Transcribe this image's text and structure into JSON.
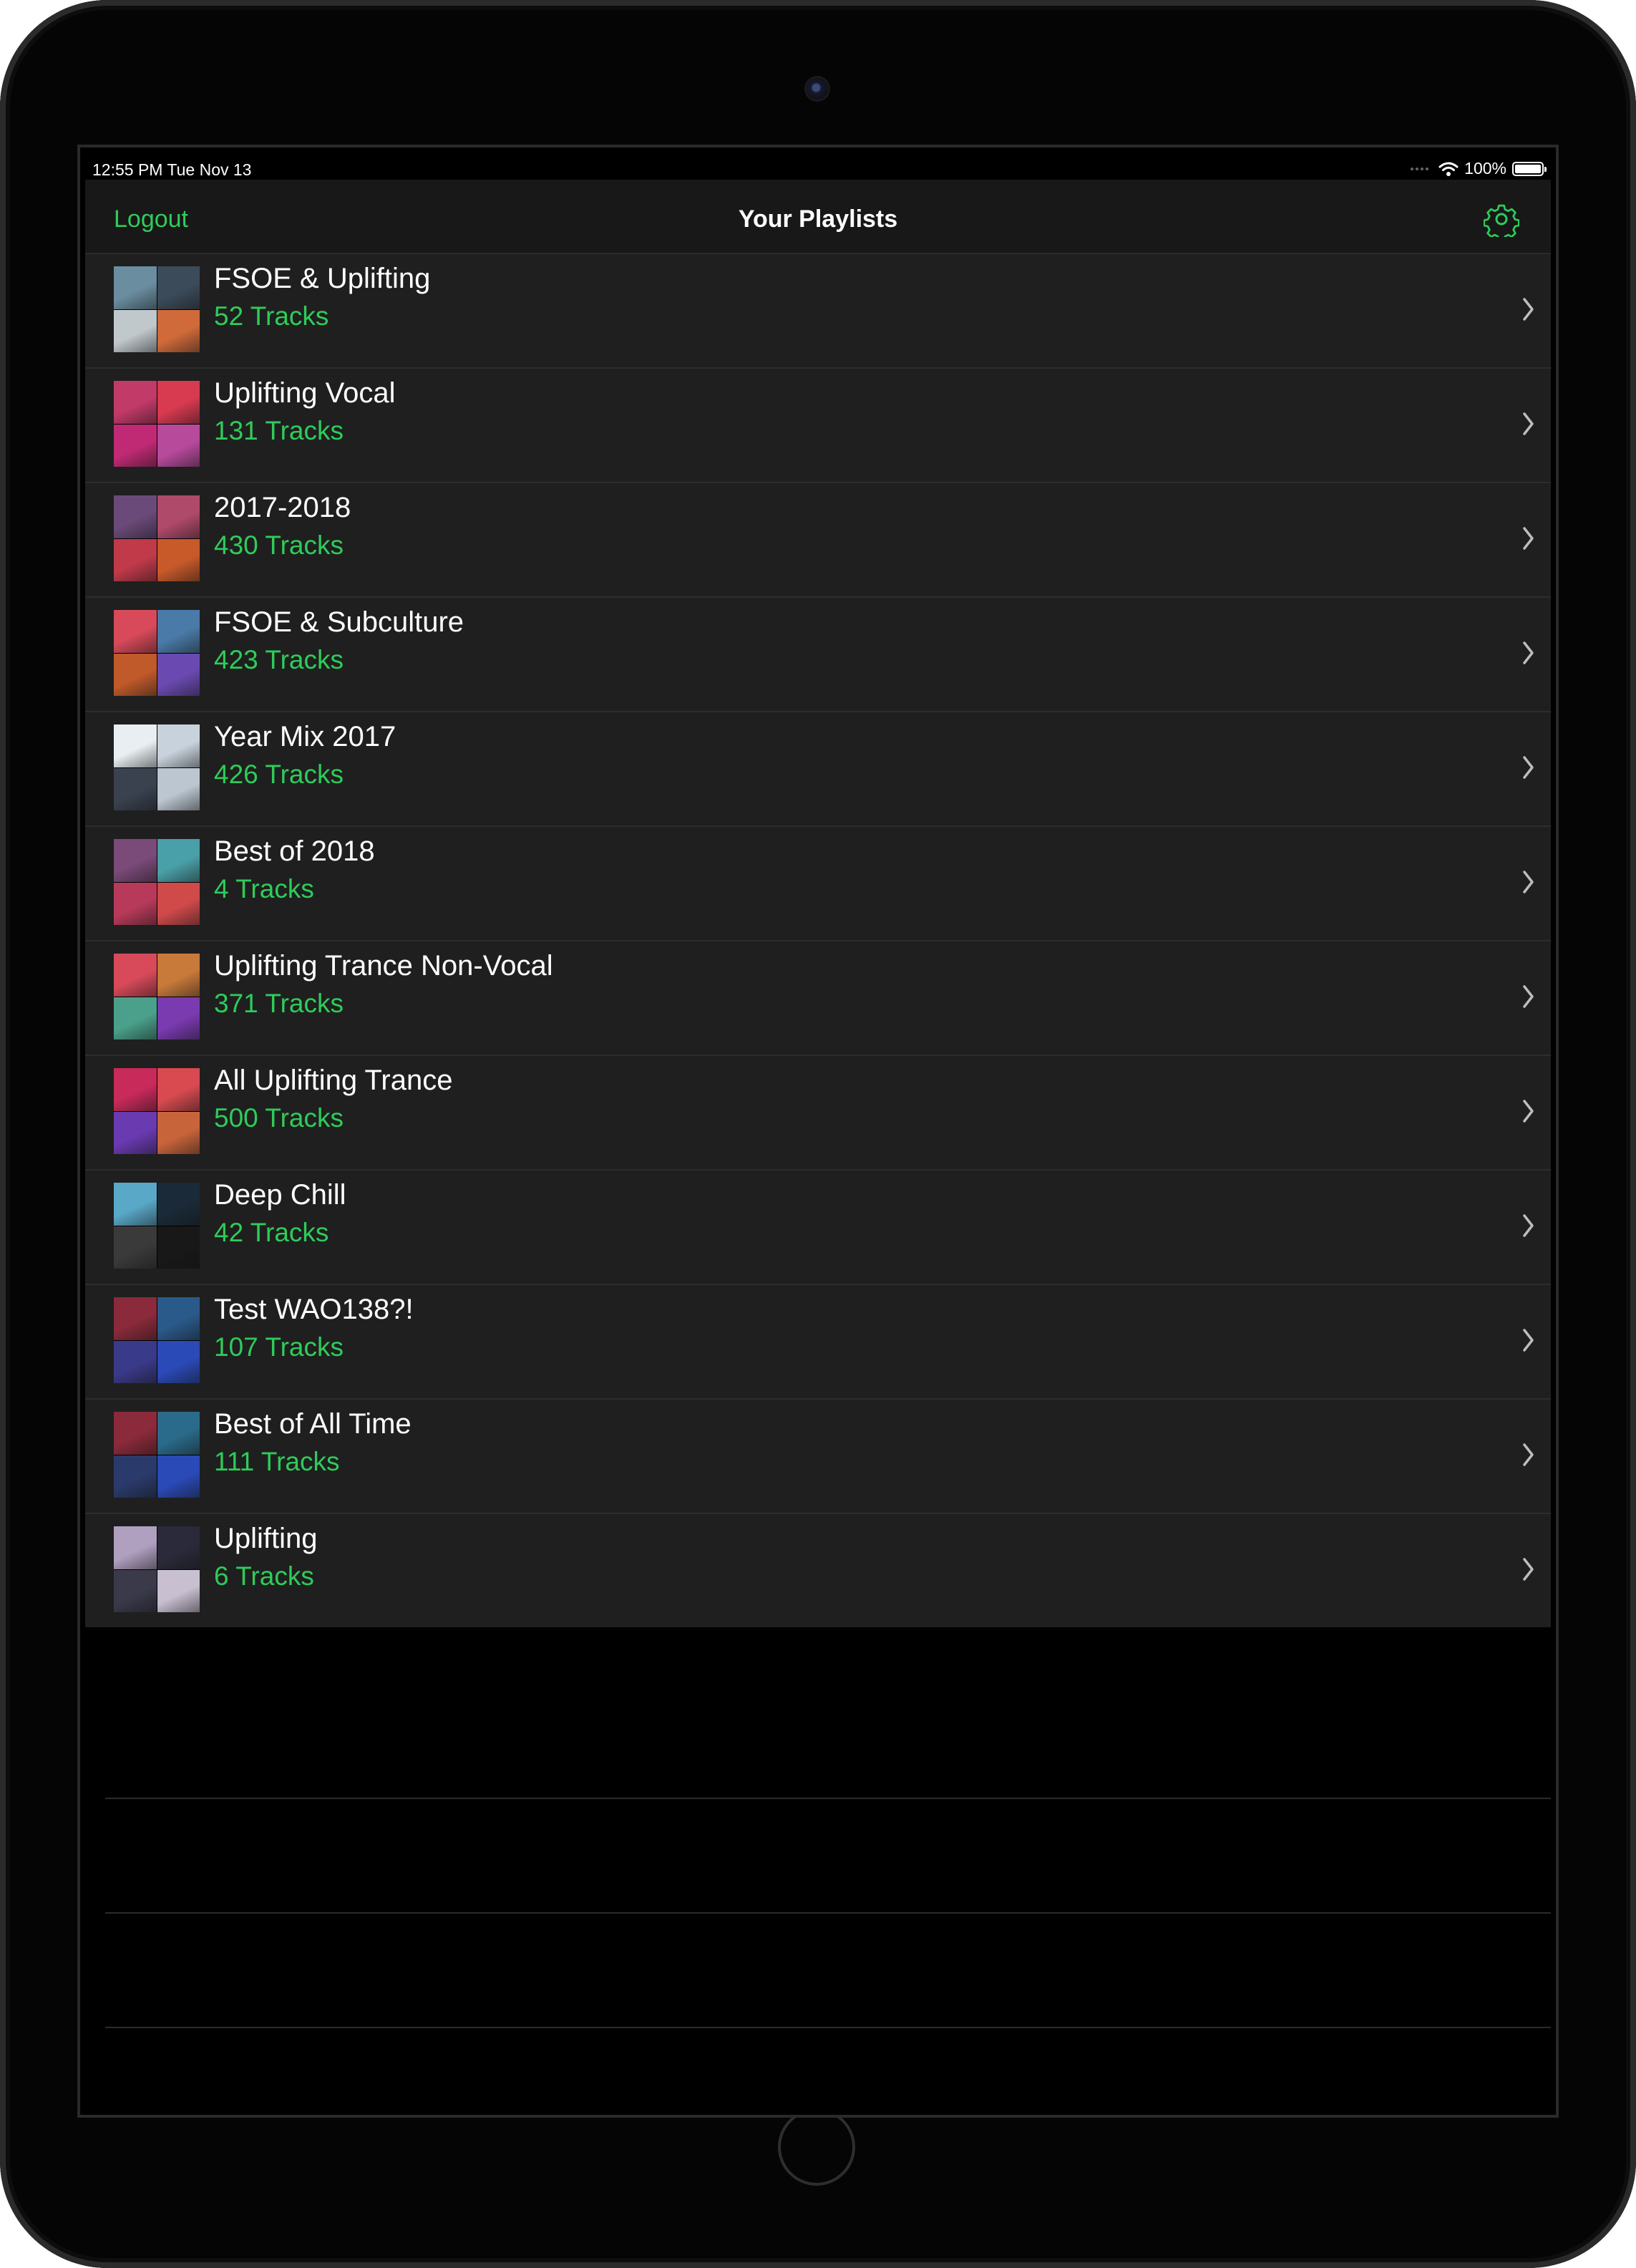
{
  "status_bar": {
    "time": "12:55 PM   Tue Nov 13",
    "battery": "100%"
  },
  "nav": {
    "left": "Logout",
    "title": "Your Playlists",
    "right_icon": "gear-icon"
  },
  "colors": {
    "accent": "#2ecc5a",
    "row_bg": "#1f1f1f",
    "nav_bg": "#181818"
  },
  "playlists": [
    {
      "name": "FSOE & Uplifting",
      "tracks": "52 Tracks",
      "art": [
        "#6a8ea0",
        "#3c4b5a",
        "#c0c8cc",
        "#d06a3a"
      ]
    },
    {
      "name": "Uplifting Vocal",
      "tracks": "131 Tracks",
      "art": [
        "#c23a68",
        "#d83a50",
        "#c02a74",
        "#b84a9c"
      ]
    },
    {
      "name": "2017-2018",
      "tracks": "430 Tracks",
      "art": [
        "#6a4a78",
        "#b04a6a",
        "#c03a4a",
        "#c85a2a"
      ]
    },
    {
      "name": "FSOE & Subculture",
      "tracks": "423 Tracks",
      "art": [
        "#d84a5a",
        "#4a7aa8",
        "#c05a2a",
        "#6a4ab0"
      ]
    },
    {
      "name": "Year Mix 2017",
      "tracks": "426 Tracks",
      "art": [
        "#e8eef2",
        "#c8d2dc",
        "#3a4250",
        "#bcc6d0"
      ]
    },
    {
      "name": "Best of 2018",
      "tracks": "4 Tracks",
      "art": [
        "#7a4a78",
        "#4aa0a8",
        "#b83a5a",
        "#d04a4a"
      ]
    },
    {
      "name": "Uplifting Trance Non-Vocal",
      "tracks": "371 Tracks",
      "art": [
        "#d84a5a",
        "#c87a3a",
        "#4aa08a",
        "#7a3ab0"
      ]
    },
    {
      "name": "All Uplifting Trance",
      "tracks": "500 Tracks",
      "art": [
        "#c82a5a",
        "#d84a50",
        "#6a3ab0",
        "#c8643a"
      ]
    },
    {
      "name": "Deep Chill",
      "tracks": "42 Tracks",
      "art": [
        "#5aa8c8",
        "#1a2a38",
        "#3a3a3a",
        "#181818"
      ]
    },
    {
      "name": "Test WAO138?!",
      "tracks": "107 Tracks",
      "art": [
        "#8a2a3a",
        "#2a5a8a",
        "#3a3a8a",
        "#2a4ab8"
      ]
    },
    {
      "name": "Best of All Time",
      "tracks": "111 Tracks",
      "art": [
        "#8a2a3a",
        "#2a6a8a",
        "#2a3a6a",
        "#2a4ab8"
      ]
    },
    {
      "name": "Uplifting",
      "tracks": "6 Tracks",
      "art": [
        "#b0a0c0",
        "#2a2a3a",
        "#3a3a4a",
        "#c8c0d0"
      ]
    }
  ]
}
